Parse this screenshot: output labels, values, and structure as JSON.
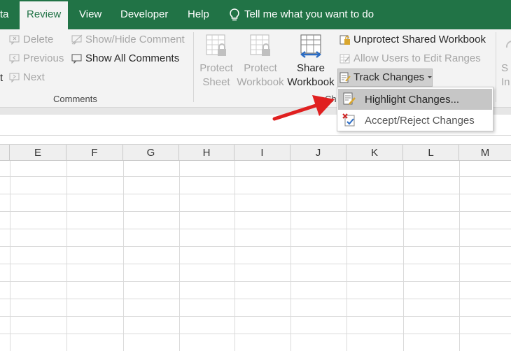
{
  "tabs": [
    {
      "label": "ta",
      "active": false
    },
    {
      "label": "Review",
      "active": true
    },
    {
      "label": "View",
      "active": false
    },
    {
      "label": "Developer",
      "active": false
    },
    {
      "label": "Help",
      "active": false
    }
  ],
  "tell_me": "Tell me what you want to do",
  "comments": {
    "delete": "Delete",
    "previous": "Previous",
    "next": "Next",
    "show_hide": "Show/Hide Comment",
    "show_all": "Show All Comments",
    "group_label": "Comments",
    "partial_left": "t"
  },
  "changes": {
    "protect_sheet": [
      "Protect",
      "Sheet"
    ],
    "protect_workbook": [
      "Protect",
      "Workbook"
    ],
    "share_workbook": [
      "Share",
      "Workbook"
    ],
    "unprotect_shared": "Unprotect Shared Workbook",
    "allow_users": "Allow Users to Edit Ranges",
    "track_changes": "Track Changes",
    "group_label_partial": "Ch",
    "partial_right": [
      "S",
      "In"
    ]
  },
  "dropdown": {
    "highlight": "Highlight Changes...",
    "accept_reject": "Accept/Reject Changes"
  },
  "columns": [
    "E",
    "F",
    "G",
    "H",
    "I",
    "J",
    "K",
    "L",
    "M"
  ],
  "colors": {
    "ribbon_green": "#217346",
    "ribbon_bg": "#f3f3f3",
    "arrow_red": "#e02020"
  }
}
